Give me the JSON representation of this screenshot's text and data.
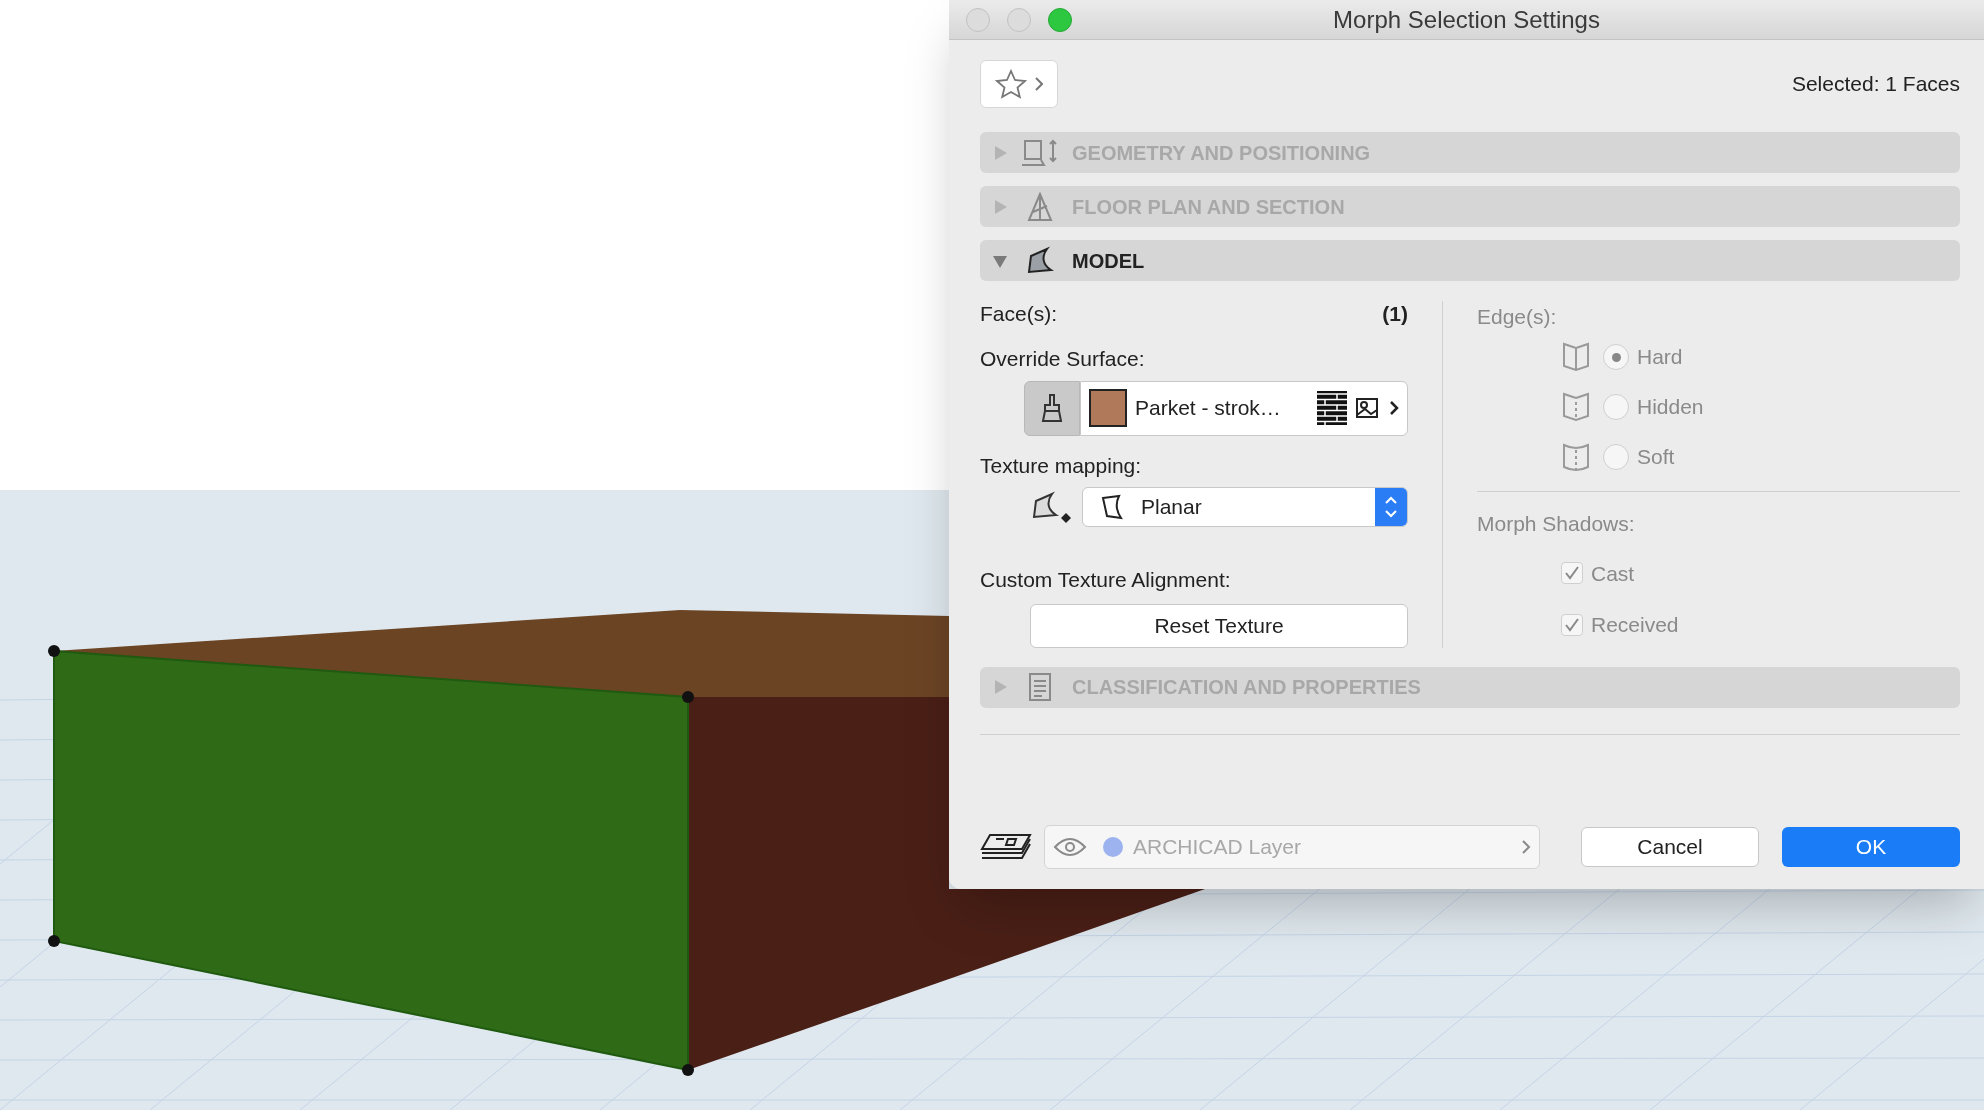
{
  "window": {
    "title": "Morph Selection Settings"
  },
  "selection_info": "Selected: 1 Faces",
  "panels": [
    {
      "title": "GEOMETRY AND POSITIONING",
      "expanded": false
    },
    {
      "title": "FLOOR PLAN AND SECTION",
      "expanded": false
    },
    {
      "title": "MODEL",
      "expanded": true
    },
    {
      "title": "CLASSIFICATION AND PROPERTIES",
      "expanded": false
    }
  ],
  "model": {
    "faces_label": "Face(s):",
    "faces_count": "(1)",
    "override_label": "Override Surface:",
    "override_on": true,
    "surface": "Parket - strok…",
    "texture_mapping_label": "Texture mapping:",
    "texture_mapping": "Planar",
    "alignment_label": "Custom Texture Alignment:",
    "reset_button": "Reset Texture",
    "edges": {
      "label": "Edge(s):",
      "disabled": true,
      "options": [
        {
          "label": "Hard",
          "selected": true
        },
        {
          "label": "Hidden",
          "selected": false
        },
        {
          "label": "Soft",
          "selected": false
        }
      ]
    },
    "shadows": {
      "label": "Morph Shadows:",
      "disabled": true,
      "options": [
        {
          "label": "Cast",
          "checked": true
        },
        {
          "label": "Received",
          "checked": true
        }
      ]
    }
  },
  "footer": {
    "layer": "ARCHICAD Layer",
    "cancel": "Cancel",
    "ok": "OK"
  }
}
